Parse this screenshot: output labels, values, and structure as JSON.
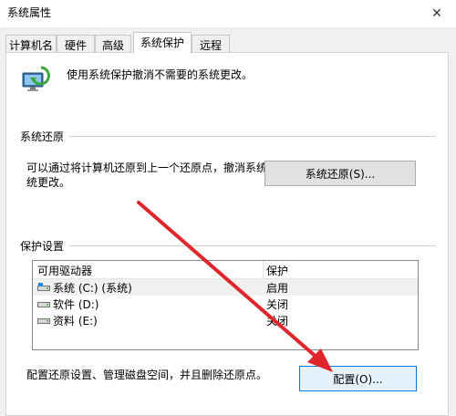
{
  "window": {
    "title": "系统属性"
  },
  "tabs": [
    {
      "label": "计算机名"
    },
    {
      "label": "硬件"
    },
    {
      "label": "高级"
    },
    {
      "label": "系统保护"
    },
    {
      "label": "远程"
    }
  ],
  "intro": {
    "text": "使用系统保护撤消不需要的系统更改。"
  },
  "restore": {
    "group_label": "系统还原",
    "desc_line1": "可以通过将计算机还原到上一个还原点，撤消系统",
    "desc_line2": "统更改。",
    "button_label": "系统还原(S)..."
  },
  "protection": {
    "group_label": "保护设置",
    "columns": {
      "drive": "可用驱动器",
      "status": "保护"
    },
    "rows": [
      {
        "name": "系统 (C:) (系统)",
        "status": "启用"
      },
      {
        "name": "软件 (D:)",
        "status": "关闭"
      },
      {
        "name": "资料 (E:)",
        "status": "关闭"
      }
    ],
    "configure_desc": "配置还原设置、管理磁盘空间，并且删除还原点。",
    "configure_button": "配置(O)..."
  },
  "colors": {
    "arrow": "#e0262a",
    "focus": "#0078d7"
  }
}
